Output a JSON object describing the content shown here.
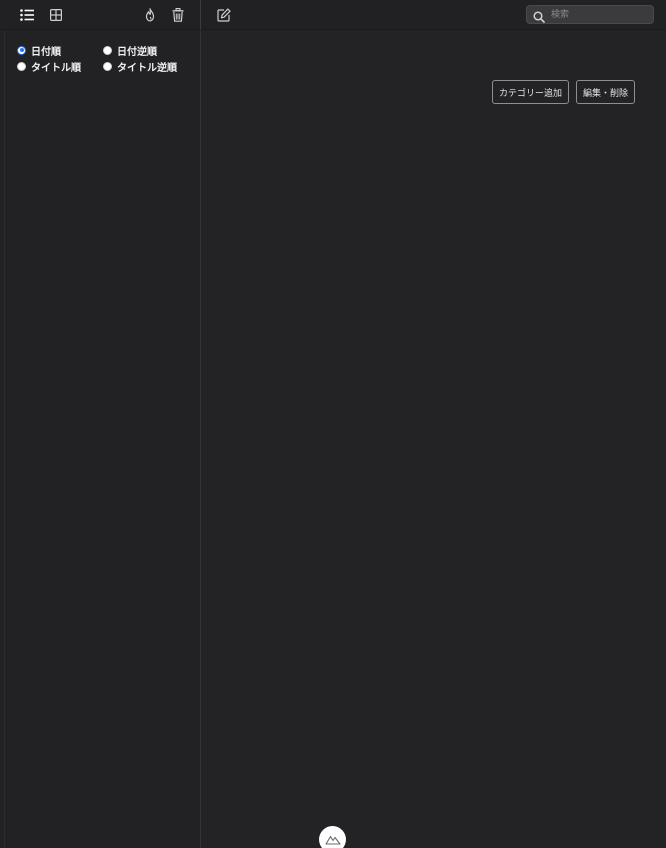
{
  "toolbar": {
    "icons": {
      "list_view": "list-view-icon",
      "grid_view": "grid-view-icon",
      "flame": "flame-icon",
      "trash": "trash-icon",
      "compose": "compose-icon"
    },
    "search": {
      "placeholder": "検索",
      "value": ""
    }
  },
  "sidebar": {
    "sort_options": [
      {
        "label": "日付順",
        "checked": true
      },
      {
        "label": "日付逆順",
        "checked": false
      },
      {
        "label": "タイトル順",
        "checked": false
      },
      {
        "label": "タイトル逆順",
        "checked": false
      }
    ]
  },
  "main": {
    "add_category_label": "カテゴリー追加",
    "edit_delete_label": "編集・削除"
  },
  "colors": {
    "background": "#232224",
    "radio_accent": "#2b74e8",
    "button_border": "#8f8e91"
  }
}
